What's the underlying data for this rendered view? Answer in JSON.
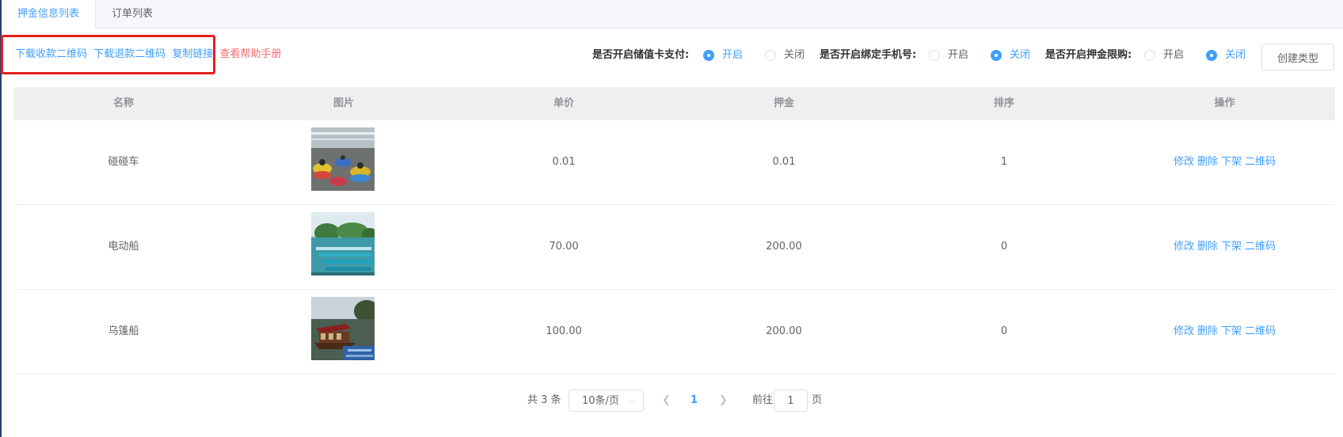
{
  "tabs": [
    {
      "label": "押金信息列表",
      "active": true
    },
    {
      "label": "订单列表",
      "active": false
    }
  ],
  "actions": {
    "download_pay_qr": "下载收款二维码",
    "download_refund_qr": "下载退款二维码",
    "copy_link": "复制链接",
    "help_manual": "查看帮助手册"
  },
  "settings": {
    "stored_value_label": "是否开启储值卡支付:",
    "stored_value_on": "开启",
    "stored_value_off": "关闭",
    "stored_value_selected": "on",
    "bind_phone_label": "是否开启绑定手机号:",
    "bind_phone_on": "开启",
    "bind_phone_off": "关闭",
    "bind_phone_selected": "off",
    "deposit_limit_label": "是否开启押金限购:",
    "deposit_limit_on": "开启",
    "deposit_limit_off": "关闭",
    "deposit_limit_selected": "off"
  },
  "create_button": "创建类型",
  "table": {
    "headers": {
      "name": "名称",
      "image": "图片",
      "price": "单价",
      "deposit": "押金",
      "sort": "排序",
      "ops": "操作"
    },
    "rows": [
      {
        "name": "碰碰车",
        "price": "0.01",
        "deposit": "0.01",
        "sort": "1",
        "image": "bumper-cars-photo"
      },
      {
        "name": "电动船",
        "price": "70.00",
        "deposit": "200.00",
        "sort": "0",
        "image": "electric-boats-photo"
      },
      {
        "name": "乌篷船",
        "price": "100.00",
        "deposit": "200.00",
        "sort": "0",
        "image": "canopy-boat-photo"
      }
    ],
    "op_labels": {
      "edit": "修改",
      "delete": "删除",
      "offline": "下架",
      "qrcode": "二维码"
    }
  },
  "pagination": {
    "total": "共 3 条",
    "page_size": "10条/页",
    "current_page": "1",
    "goto_label": "前往",
    "goto_value": "1",
    "goto_suffix": "页"
  },
  "colors": {
    "primary": "#409eff",
    "danger": "#f56c6c",
    "highlight": "#e51f1f",
    "header_bg": "#efefef"
  }
}
